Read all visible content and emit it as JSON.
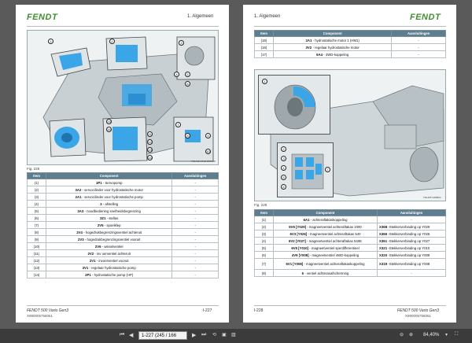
{
  "left_page": {
    "logo": "FENDT",
    "chapter": "1. Algemeen",
    "figure_caption": "Fig. 226",
    "figure_id": "TRL465 STC8 ERROR",
    "callouts": [
      "1",
      "2",
      "3",
      "4",
      "5",
      "6",
      "7",
      "8",
      "9",
      "10",
      "11",
      "12",
      "13",
      "14",
      "15",
      "16"
    ],
    "table": {
      "headers": [
        "Item",
        "Component",
        "Aansluitingen"
      ],
      "rows": [
        {
          "item": "(1)",
          "code": "1P1",
          "desc": " - Servopomp",
          "conn": "-"
        },
        {
          "item": "(2)",
          "code": "3A2",
          "desc": " - servocilinder voor hydrostatische motor",
          "conn": "-"
        },
        {
          "item": "(3)",
          "code": "2A1",
          "desc": " - servocilinder voor hydrostatische pomp",
          "conn": "-"
        },
        {
          "item": "(4)",
          "code": "3",
          "desc": " - afstelling",
          "conn": "-"
        },
        {
          "item": "(5)",
          "code": "3A3",
          "desc": " - noodbediening snelheidsbegrenzing",
          "conn": "-"
        },
        {
          "item": "(6)",
          "code": "3Z1",
          "desc": " - stellas",
          "conn": "-"
        },
        {
          "item": "(7)",
          "code": "2V5",
          "desc": " - spoelklep",
          "conn": "-"
        },
        {
          "item": "(8)",
          "code": "2V4",
          "desc": " - hogedrukbegrenzingsventiel achteruit",
          "conn": "-"
        },
        {
          "item": "(9)",
          "code": "2V3",
          "desc": " - hogedrukbegrenzingsventiel vooruit",
          "conn": "-"
        },
        {
          "item": "(10)",
          "code": "2V6",
          "desc": " - wisselventiel",
          "conn": "-"
        },
        {
          "item": "(11)",
          "code": "2V2",
          "desc": " - inv oerventiel achteruit",
          "conn": "-"
        },
        {
          "item": "(12)",
          "code": "2V1",
          "desc": " - invoerventiel vooruit",
          "conn": "-"
        },
        {
          "item": "(13)",
          "code": "3V1",
          "desc": " - regelaar hydrostatische pomp",
          "conn": "-"
        },
        {
          "item": "(14)",
          "code": "2P1",
          "desc": " - hydrostatische pomp (HP)",
          "conn": "-"
        }
      ]
    },
    "footer_model": "FENDT 500 Vario Gen3",
    "footer_number": "X990005756061",
    "page_number": "I-227"
  },
  "right_page": {
    "logo": "FENDT",
    "chapter": "1. Algemeen",
    "figure_caption": "Fig. 228",
    "figure_id": "TRL465 S488DC",
    "callouts": [
      "1",
      "2",
      "3",
      "4",
      "5",
      "6",
      "7"
    ],
    "top_table": {
      "headers": [
        "Item",
        "Component",
        "Aansluitingen"
      ],
      "rows": [
        {
          "item": "(15)",
          "code": "2A1",
          "desc": " - hydrostatische motor 1 (HM1)",
          "conn": "-"
        },
        {
          "item": "(16)",
          "code": "3V2",
          "desc": " - regelaar hydrostatische motor",
          "conn": "-"
        },
        {
          "item": "(17)",
          "code": "6A4",
          "desc": " - 4WD-koppeling",
          "conn": "-"
        }
      ]
    },
    "bottom_table": {
      "headers": [
        "Item",
        "Component",
        "Aansluitingen"
      ],
      "rows": [
        {
          "item": "(1)",
          "code": "6A1",
          "desc": " - achteraftakaskoppeling",
          "conn_code": "",
          "conn": "-"
        },
        {
          "item": "(2)",
          "code": "6V6 [Y029]",
          "desc": " - magneetventiel achteraftakas 1000",
          "conn_code": "X368",
          "conn": " -Stekkerverbinding op Y029"
        },
        {
          "item": "(3)",
          "code": "6V3 [Y026]",
          "desc": " - magneetventiel achteraftakas 540",
          "conn_code": "X366",
          "conn": " -Stekkerverbinding op Y026"
        },
        {
          "item": "(4)",
          "code": "6V2 [Y027]",
          "desc": " - magneetventiel achteraftakas 540E",
          "conn_code": "X361",
          "conn": " -Stekkerverbinding op Y027"
        },
        {
          "item": "(5)",
          "code": "6V5 [Y010]",
          "desc": " - magneetventiel sperdifferentieel",
          "conn_code": "X321",
          "conn": " -Stekkerverbinding op Y010"
        },
        {
          "item": "(6)",
          "code": "4V9 [Y009]",
          "desc": " - magneetventiel 4WD-koppeling",
          "conn_code": "X320",
          "conn": " -Stekkerverbinding op Y009"
        },
        {
          "item": "(7)",
          "code": "6V1 [Y008]",
          "desc": " - magneetventiel achteraftakaskoppeling",
          "conn_code": "X319",
          "conn": " -Stekkerverbinding op Y008"
        },
        {
          "item": "(8)",
          "code": "6",
          "desc": " - ventiel achterasafscherming",
          "conn_code": "",
          "conn": "-"
        }
      ]
    },
    "footer_model": "FENDT 500 Vario Gen3",
    "footer_number": "X990005756061",
    "page_number": "I-228"
  },
  "toolbar": {
    "page_input": "1-227 (245 / 166",
    "zoom": "84,40%",
    "colors": {
      "bar": "#3b3b3b",
      "accent_blue": "#3aa6e8",
      "table_header": "#5d7e8e",
      "fendt_green": "#3f8f2f"
    }
  }
}
